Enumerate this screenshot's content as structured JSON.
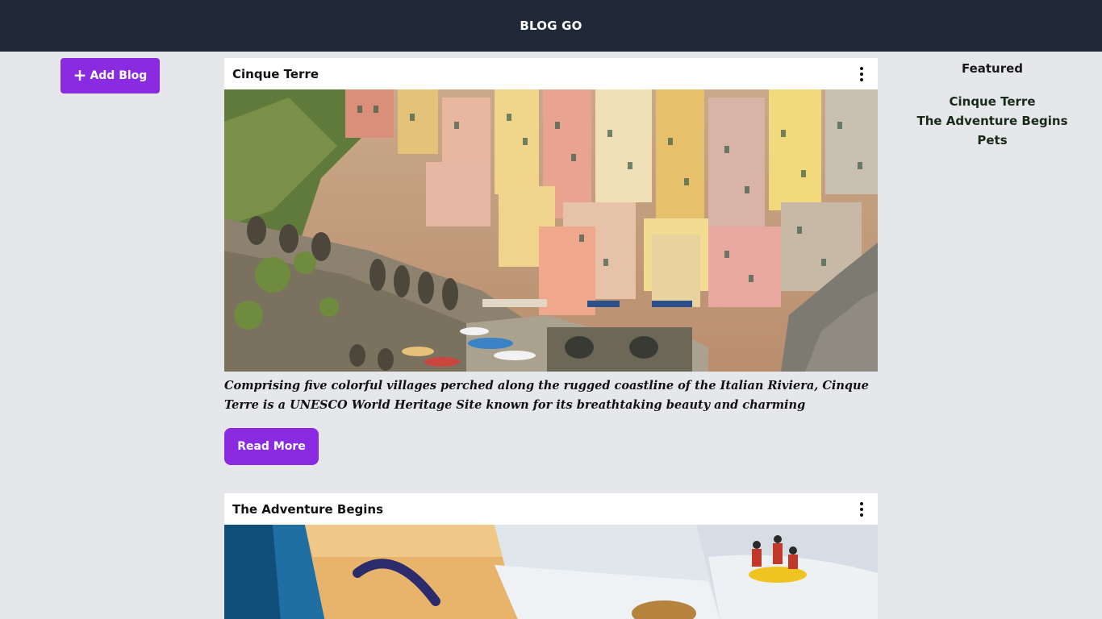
{
  "header": {
    "brand": "BLOG GO"
  },
  "actions": {
    "add_blog_label": "Add Blog"
  },
  "posts": [
    {
      "title": "Cinque Terre",
      "excerpt": "Comprising five colorful villages perched along the rugged coastline of the Italian Riviera, Cinque Terre is a UNESCO World Heritage Site known for its breathtaking beauty and charming atmosphere. With its pastel-",
      "read_more_label": "Read More"
    },
    {
      "title": "The Adventure Begins"
    }
  ],
  "featured": {
    "heading": "Featured",
    "items": [
      "Cinque Terre",
      "The Adventure Begins",
      "Pets"
    ]
  },
  "colors": {
    "header_bg": "#1f2937",
    "accent": "#8a2be2",
    "page_bg": "#e5e7eb"
  }
}
